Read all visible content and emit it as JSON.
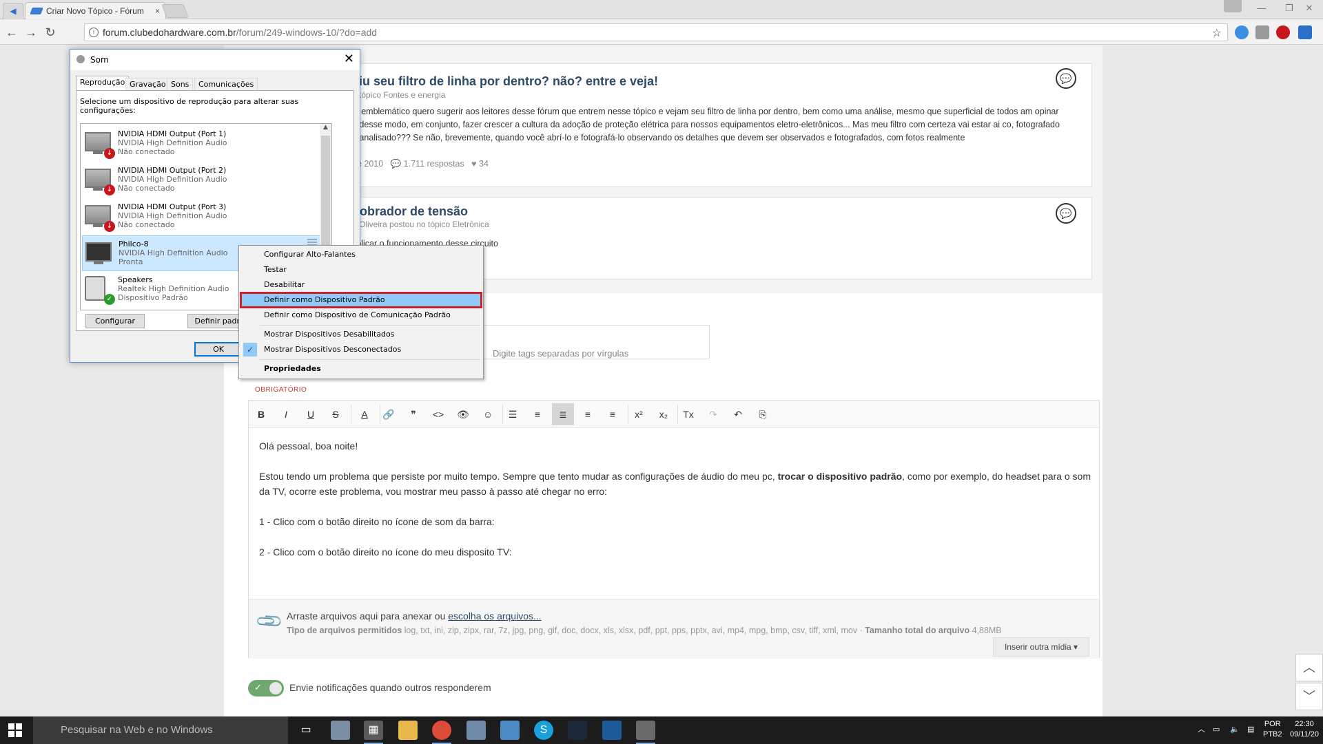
{
  "browser": {
    "tab_title": "Criar Novo Tópico - Fórum",
    "tab_close": "×",
    "url_domain": "forum.clubedohardware.com.br",
    "url_path": "/forum/249-windows-10/?do=add",
    "nav": {
      "back": "←",
      "forward": "→",
      "reload": "↻"
    },
    "star": "☆",
    "window_controls": {
      "minimize": "—",
      "restore": "❐",
      "close": "✕"
    }
  },
  "feed": {
    "items": [
      {
        "title": "viu seu filtro de linha por dentro? não? entre e veja!",
        "meta": "o tópico Fontes e energia",
        "excerpt": "lo emblemático quero sugerir aos leitores desse fórum que entrem nesse tópico e vejam seu filtro de linha por dentro, bem como uma análise, mesmo que superficial de todos am opinar e desse modo, em conjunto, fazer crescer a cultura da adoção de proteção elétrica para nossos equipamentos eletro-eletrônicos... Mas meu filtro com certeza vai estar ai co, fotografado e analisado??? Se não, brevemente, quando você abrí-lo e fotografá-lo observando os detalhes que devem ser observados e fotografados, com fotos realmente",
        "date": "de 2010",
        "replies": "1.711 respostas",
        "likes": "34"
      },
      {
        "title": "dobrador de tensão",
        "meta": "e Oliveira postou no tópico Eletrônica",
        "excerpt": "xplicar o funcionamento desse circuito"
      }
    ]
  },
  "form": {
    "tags_placeholder": "Digite tags separadas por vírgulas",
    "required_label": "OBRIGATÓRIO",
    "editor_toolbar": [
      "B",
      "I",
      "U",
      "S",
      "A",
      "🔗",
      "❞",
      "<>",
      "👁",
      "☺",
      "☰",
      "≡",
      "≣",
      "≡",
      "≡",
      "x²",
      "x₂",
      "Tx",
      "↷",
      "↶",
      "⎘"
    ],
    "body": {
      "p1": "Olá pessoal, boa noite!",
      "p2_start": "Estou tendo um problema que persiste por muito tempo. Sempre que tento mudar as configurações de áudio do meu pc, ",
      "p2_bold": "trocar o dispositivo padrão",
      "p2_end": ", como por exemplo, do headset para o som da TV, ocorre este problema, vou mostrar meu passo à passo até chegar no erro:",
      "p3": "1 - Clico com o botão direito no ícone de som da barra:",
      "p4": "2 - Clico com o botão direito no ícone do meu disposito TV:"
    },
    "attach": {
      "drop_text": "Arraste arquivos aqui para anexar ou ",
      "choose_link": "escolha os arquivos...",
      "types_label": "Tipo de arquivos permitidos",
      "types_list": "log, txt, ini, zip, zipx, rar, 7z, jpg, png, gif, doc, docx, xls, xlsx, pdf, ppt, pps, pptx, avi, mp4, mpg, bmp, csv, tiff, xml, mov ·",
      "size_label": "Tamanho total do arquivo",
      "size_value": "4,88MB",
      "insert_button": "Inserir outra mídia ▾"
    },
    "notify_label": "Envie notificações quando outros responderem"
  },
  "sound_dialog": {
    "title": "Som",
    "close": "✕",
    "tabs": [
      "Reprodução",
      "Gravação",
      "Sons",
      "Comunicações"
    ],
    "hint": "Selecione um dispositivo de reprodução para alterar suas configurações:",
    "devices": [
      {
        "name": "NVIDIA HDMI Output (Port 1)",
        "driver": "NVIDIA High Definition Audio",
        "status": "Não conectado"
      },
      {
        "name": "NVIDIA HDMI Output (Port 2)",
        "driver": "NVIDIA High Definition Audio",
        "status": "Não conectado"
      },
      {
        "name": "NVIDIA HDMI Output (Port 3)",
        "driver": "NVIDIA High Definition Audio",
        "status": "Não conectado"
      },
      {
        "name": "Philco-8",
        "driver": "NVIDIA High Definition Audio",
        "status": "Pronta"
      },
      {
        "name": "Speakers",
        "driver": "Realtek High Definition Audio",
        "status": "Dispositivo Padrão"
      }
    ],
    "buttons": {
      "configure": "Configurar",
      "set_default": "Definir padrão",
      "ok": "OK"
    }
  },
  "context_menu": {
    "items": [
      "Configurar Alto-Falantes",
      "Testar",
      "Desabilitar",
      "Definir como Dispositivo Padrão",
      "Definir como Dispositivo de Comunicação Padrão",
      "Mostrar Dispositivos Desabilitados",
      "Mostrar Dispositivos Desconectados",
      "Propriedades"
    ],
    "checkmark": "✓"
  },
  "taskbar": {
    "search_placeholder": "Pesquisar na Web e no Windows",
    "language": "POR",
    "layout": "PTB2",
    "time": "22:30",
    "date": "09/11/20"
  },
  "colors": {
    "highlight": "#91c9f7",
    "red_box": "#d0202a",
    "link": "#2e4a68"
  }
}
